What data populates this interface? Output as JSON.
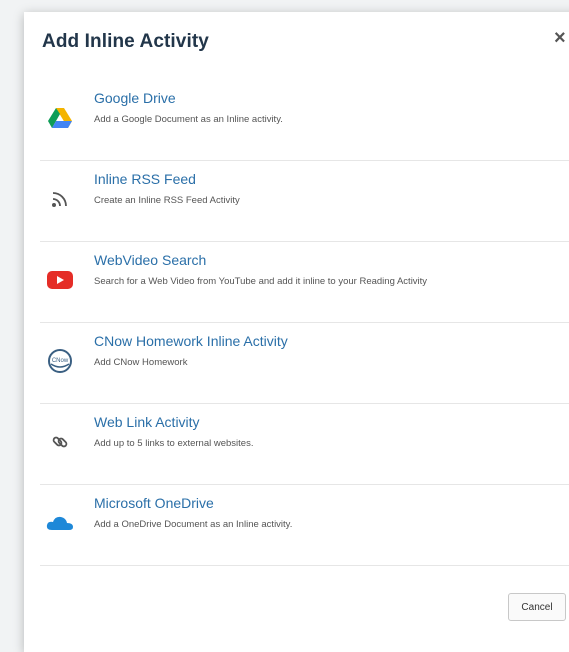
{
  "dialog": {
    "title": "Add Inline Activity",
    "close_label": "×",
    "cancel_label": "Cancel"
  },
  "activities": [
    {
      "name": "Google Drive",
      "description": "Add a Google Document as an Inline activity.",
      "icon": "google-drive-icon"
    },
    {
      "name": "Inline RSS Feed",
      "description": "Create an Inline RSS Feed Activity",
      "icon": "rss-feed-icon"
    },
    {
      "name": "WebVideo Search",
      "description": "Search for a Web Video from YouTube and add it inline to your Reading Activity",
      "icon": "youtube-icon"
    },
    {
      "name": "CNow Homework Inline Activity",
      "description": "Add CNow Homework",
      "icon": "cnow-icon"
    },
    {
      "name": "Web Link Activity",
      "description": "Add up to 5 links to external websites.",
      "icon": "link-icon"
    },
    {
      "name": "Microsoft OneDrive",
      "description": "Add a OneDrive Document as an Inline activity.",
      "icon": "onedrive-icon"
    }
  ],
  "colors": {
    "title": "#22364a",
    "item_name": "#2a6fa8",
    "youtube_red": "#e52d27",
    "onedrive_blue": "#1e88d8"
  }
}
